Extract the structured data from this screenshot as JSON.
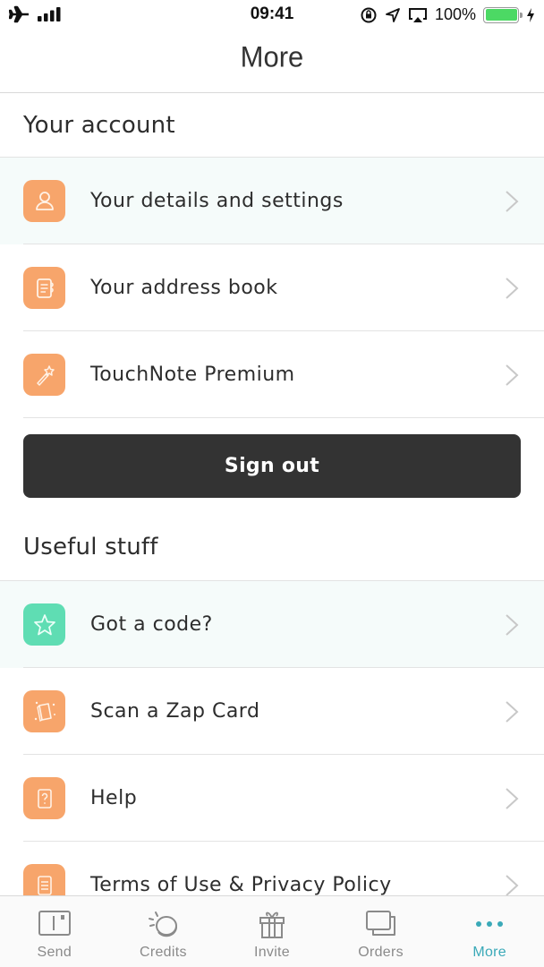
{
  "status_bar": {
    "time": "09:41",
    "battery_percent": "100%",
    "battery_level": 1.0,
    "icons": [
      "airplane-icon",
      "signal-icon",
      "rotation-lock-icon",
      "location-icon",
      "airplay-icon",
      "battery-icon",
      "charging-icon"
    ]
  },
  "header": {
    "title": "More"
  },
  "sections": [
    {
      "title": "Your account",
      "items": [
        {
          "label": "Your details and settings",
          "icon": "person-icon",
          "color": "#f7a56b",
          "highlighted": true
        },
        {
          "label": "Your address book",
          "icon": "address-book-icon",
          "color": "#f7a56b",
          "highlighted": false
        },
        {
          "label": "TouchNote Premium",
          "icon": "magic-wand-icon",
          "color": "#f7a56b",
          "highlighted": false
        }
      ]
    },
    {
      "title": "Useful stuff",
      "items": [
        {
          "label": "Got a code?",
          "icon": "star-icon",
          "color": "#5fddb3",
          "highlighted": true
        },
        {
          "label": "Scan a Zap Card",
          "icon": "zap-card-icon",
          "color": "#f7a56b",
          "highlighted": false
        },
        {
          "label": "Help",
          "icon": "help-icon",
          "color": "#f7a56b",
          "highlighted": false
        },
        {
          "label": "Terms of Use & Privacy Policy",
          "icon": "document-icon",
          "color": "#f7a56b",
          "highlighted": false
        }
      ]
    }
  ],
  "sign_out": {
    "label": "Sign out"
  },
  "tab_bar": {
    "active_color": "#3aa9b8",
    "inactive_color": "#8a8a8a",
    "tabs": [
      {
        "label": "Send",
        "icon": "postcard-icon",
        "active": false
      },
      {
        "label": "Credits",
        "icon": "coin-icon",
        "active": false
      },
      {
        "label": "Invite",
        "icon": "gift-icon",
        "active": false
      },
      {
        "label": "Orders",
        "icon": "orders-icon",
        "active": false
      },
      {
        "label": "More",
        "icon": "more-dots-icon",
        "active": true
      }
    ]
  }
}
